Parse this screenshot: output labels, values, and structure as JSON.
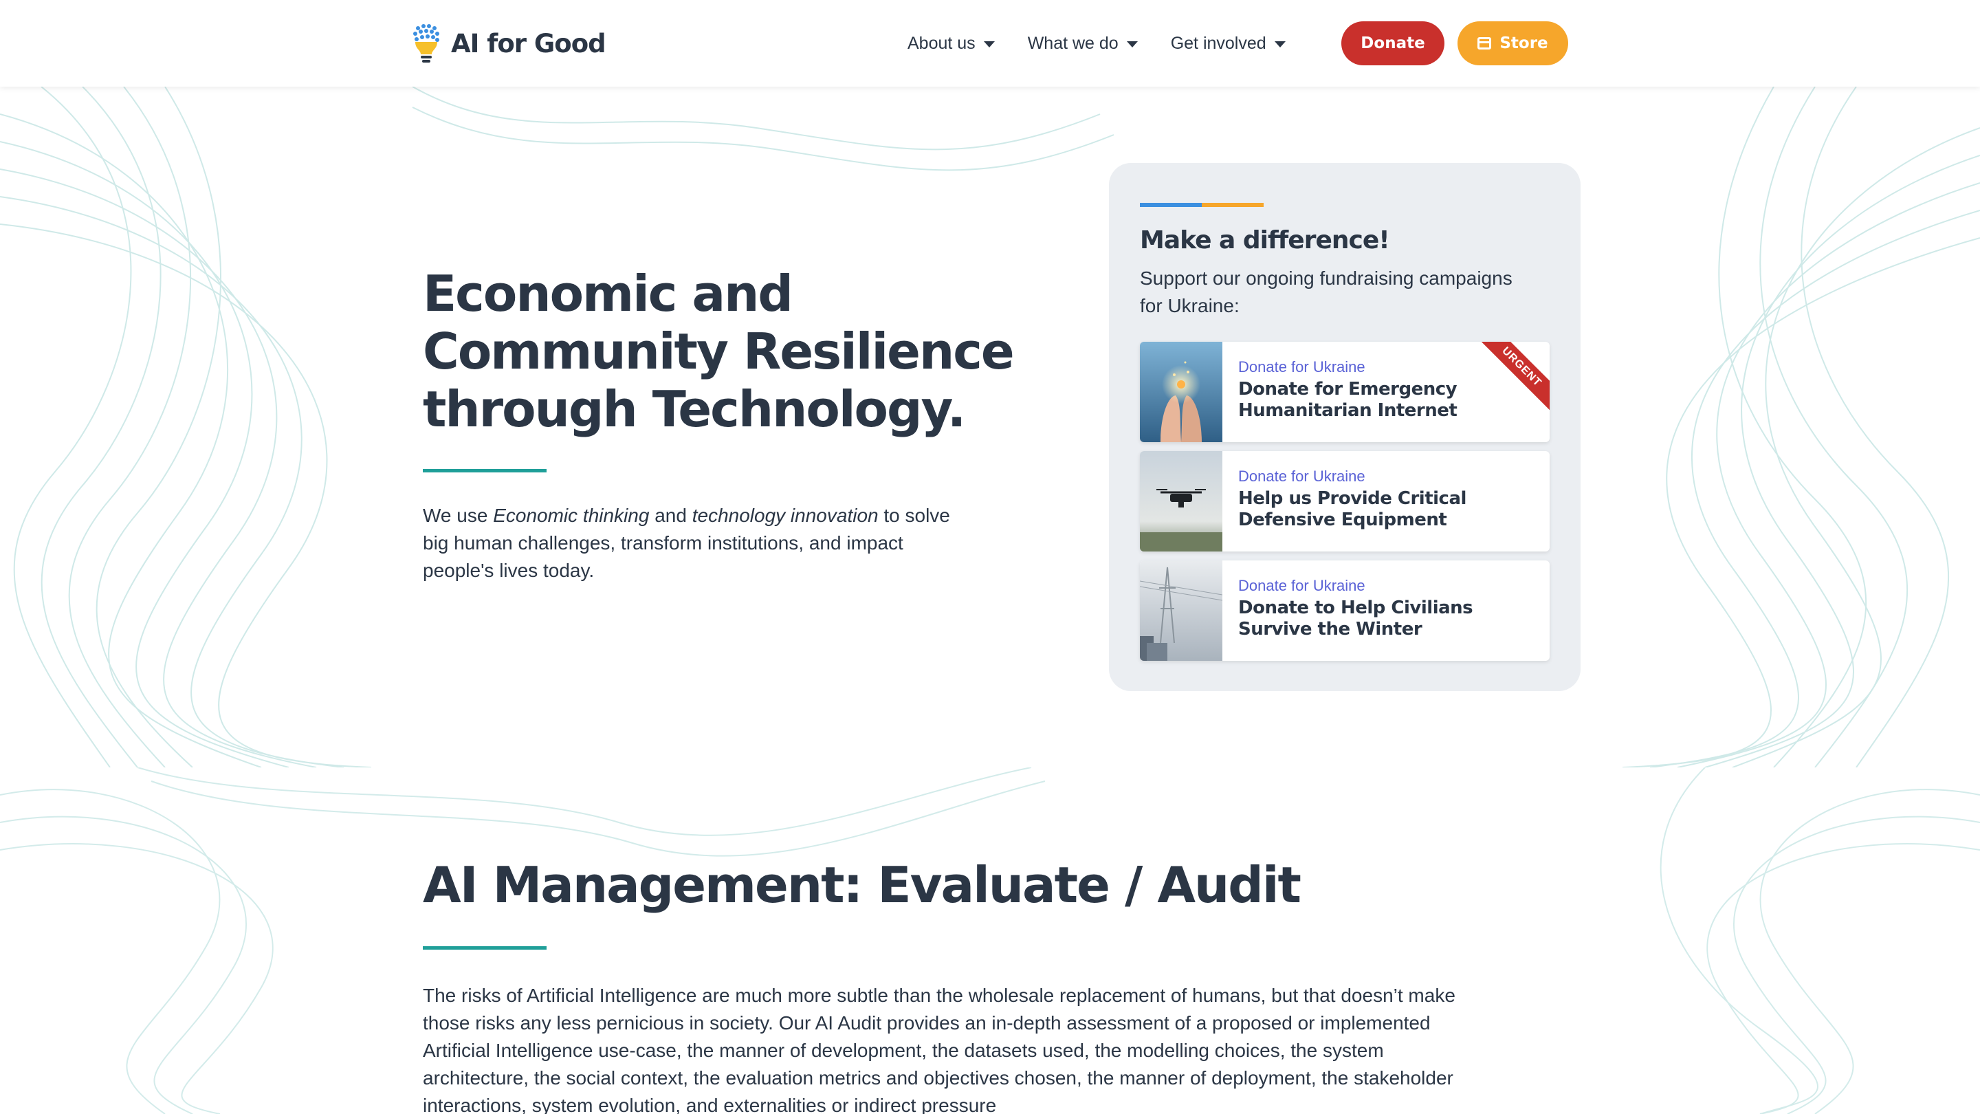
{
  "header": {
    "logo_text": "AI for Good",
    "nav": [
      {
        "label": "About us"
      },
      {
        "label": "What we do"
      },
      {
        "label": "Get involved"
      }
    ],
    "donate_label": "Donate",
    "store_label": "Store"
  },
  "hero": {
    "title": "Economic and\nCommunity Resilience\nthrough Technology.",
    "desc_part1": "We use ",
    "desc_em1": "Economic thinking",
    "desc_part2": " and ",
    "desc_em2": "technology innovation",
    "desc_part3": " to solve big human challenges, transform institutions, and impact people's lives today."
  },
  "card": {
    "title": "Make a difference!",
    "subtitle": "Support our ongoing fundraising campaigns for Ukraine:",
    "campaigns": [
      {
        "tag": "Donate for Ukraine",
        "title": "Donate for Emergency Humanitarian Internet",
        "ribbon": "URGENT"
      },
      {
        "tag": "Donate for Ukraine",
        "title": "Help us Provide Critical Defensive Equipment"
      },
      {
        "tag": "Donate for Ukraine",
        "title": "Donate to Help Civilians Survive the Winter"
      }
    ]
  },
  "section2": {
    "title": "AI Management: Evaluate / Audit",
    "body": "The risks of Artificial Intelligence are much more subtle than the wholesale replacement of humans, but that doesn’t make those risks any less pernicious in society. Our AI Audit provides an in-depth assessment of a proposed or implemented Artificial Intelligence use-case, the manner of development, the datasets used, the modelling choices, the system architecture, the social context, the evaluation metrics and objectives chosen, the manner of deployment, the stakeholder interactions, system evolution, and externalities or indirect pressure"
  },
  "colors": {
    "primary_text": "#2b3645",
    "accent_teal": "#1f9f99",
    "donate_red": "#c9302c",
    "store_orange": "#f6a62b",
    "link_purple": "#5a62d6",
    "card_bg": "#ebeef2"
  },
  "icons": [
    "logo-bulb-icon",
    "caret-down-icon",
    "store-icon"
  ]
}
